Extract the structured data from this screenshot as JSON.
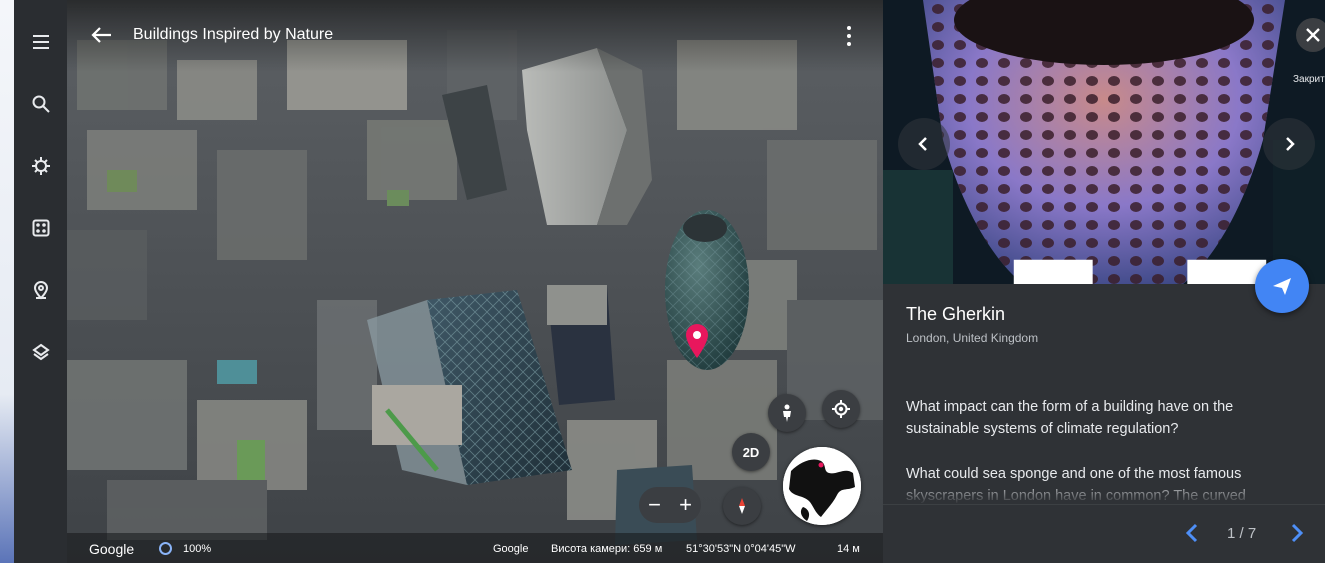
{
  "colors": {
    "accent": "#4285f4",
    "panel_bg": "#2f3236",
    "rail_bg": "#2a2d31",
    "pin": "#e8175d"
  },
  "rail": {
    "items": [
      {
        "icon": "menu-icon"
      },
      {
        "icon": "search-icon"
      },
      {
        "icon": "voyager-icon"
      },
      {
        "icon": "random-dice-icon"
      },
      {
        "icon": "projects-icon"
      },
      {
        "icon": "layers-icon"
      }
    ]
  },
  "map": {
    "title": "Buildings Inspired by Nature",
    "btn_2d": "2D",
    "zoom_out": "−",
    "zoom_in": "+",
    "status": {
      "brand": "Google",
      "load_pct": "100%",
      "attribution": "Google",
      "altitude": "Висота камери: 659 м",
      "coordinates": "51°30'53\"N 0°04'45\"W",
      "scale": "14 м"
    }
  },
  "panel": {
    "close_tooltip": "Закрити",
    "place_title": "The Gherkin",
    "place_subtitle": "London, United Kingdom",
    "paragraph_1": "What impact can the form of a building have on the sustainable systems of climate regulation?",
    "paragraph_2": "What could sea sponge and one of the most famous skyscrapers in London have in common? The curved",
    "pager": "1 / 7"
  }
}
